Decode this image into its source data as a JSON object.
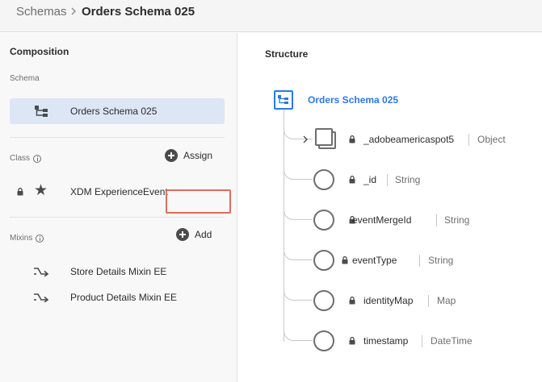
{
  "breadcrumb": {
    "root": "Schemas",
    "current": "Orders Schema 025"
  },
  "composition": {
    "title": "Composition",
    "schema_label": "Schema",
    "schema_name": "Orders Schema 025",
    "class_label": "Class",
    "assign_label": "Assign",
    "class_name": "XDM ExperienceEvent",
    "mixins_label": "Mixins",
    "add_label": "Add",
    "mixins": [
      {
        "name": "Store Details Mixin EE"
      },
      {
        "name": "Product Details Mixin EE"
      }
    ]
  },
  "structure": {
    "title": "Structure",
    "root_name": "Orders Schema 025",
    "fields": [
      {
        "name": "_adobeamericaspot5",
        "type": "Object",
        "expandable": true
      },
      {
        "name": "_id",
        "type": "String"
      },
      {
        "name": "eventMergeId",
        "type": "String"
      },
      {
        "name": "eventType",
        "type": "String"
      },
      {
        "name": "identityMap",
        "type": "Map"
      },
      {
        "name": "timestamp",
        "type": "DateTime"
      }
    ]
  },
  "colors": {
    "accent": "#2a7ae2",
    "highlight_border": "#e06b5b",
    "selected_row": "#dde6f5"
  },
  "icons": {
    "breadcrumb_separator": "chevron-right-icon",
    "schema": "schema-tree-icon",
    "class": "star-icon",
    "locked": "lock-icon",
    "mixin": "mixin-arrow-icon",
    "info": "info-icon",
    "add": "plus-circle-icon"
  }
}
